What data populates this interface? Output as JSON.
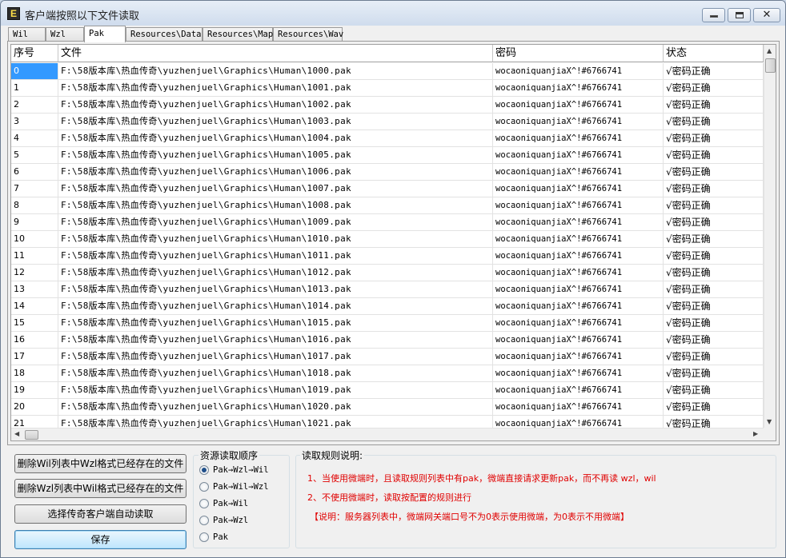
{
  "window": {
    "title": "客户端按照以下文件读取"
  },
  "tabs": [
    "Wil",
    "Wzl",
    "Pak",
    "Resources\\Data",
    "Resources\\Map",
    "Resources\\Wav"
  ],
  "active_tab": "Pak",
  "table": {
    "columns": [
      "序号",
      "文件",
      "密码",
      "状态"
    ],
    "rows": [
      [
        "0",
        "F:\\58版本库\\热血传奇\\yuzhenjuel\\Graphics\\Human\\1000.pak",
        "wocaoniquanjiaX^!#6766741",
        "√密码正确"
      ],
      [
        "1",
        "F:\\58版本库\\热血传奇\\yuzhenjuel\\Graphics\\Human\\1001.pak",
        "wocaoniquanjiaX^!#6766741",
        "√密码正确"
      ],
      [
        "2",
        "F:\\58版本库\\热血传奇\\yuzhenjuel\\Graphics\\Human\\1002.pak",
        "wocaoniquanjiaX^!#6766741",
        "√密码正确"
      ],
      [
        "3",
        "F:\\58版本库\\热血传奇\\yuzhenjuel\\Graphics\\Human\\1003.pak",
        "wocaoniquanjiaX^!#6766741",
        "√密码正确"
      ],
      [
        "4",
        "F:\\58版本库\\热血传奇\\yuzhenjuel\\Graphics\\Human\\1004.pak",
        "wocaoniquanjiaX^!#6766741",
        "√密码正确"
      ],
      [
        "5",
        "F:\\58版本库\\热血传奇\\yuzhenjuel\\Graphics\\Human\\1005.pak",
        "wocaoniquanjiaX^!#6766741",
        "√密码正确"
      ],
      [
        "6",
        "F:\\58版本库\\热血传奇\\yuzhenjuel\\Graphics\\Human\\1006.pak",
        "wocaoniquanjiaX^!#6766741",
        "√密码正确"
      ],
      [
        "7",
        "F:\\58版本库\\热血传奇\\yuzhenjuel\\Graphics\\Human\\1007.pak",
        "wocaoniquanjiaX^!#6766741",
        "√密码正确"
      ],
      [
        "8",
        "F:\\58版本库\\热血传奇\\yuzhenjuel\\Graphics\\Human\\1008.pak",
        "wocaoniquanjiaX^!#6766741",
        "√密码正确"
      ],
      [
        "9",
        "F:\\58版本库\\热血传奇\\yuzhenjuel\\Graphics\\Human\\1009.pak",
        "wocaoniquanjiaX^!#6766741",
        "√密码正确"
      ],
      [
        "10",
        "F:\\58版本库\\热血传奇\\yuzhenjuel\\Graphics\\Human\\1010.pak",
        "wocaoniquanjiaX^!#6766741",
        "√密码正确"
      ],
      [
        "11",
        "F:\\58版本库\\热血传奇\\yuzhenjuel\\Graphics\\Human\\1011.pak",
        "wocaoniquanjiaX^!#6766741",
        "√密码正确"
      ],
      [
        "12",
        "F:\\58版本库\\热血传奇\\yuzhenjuel\\Graphics\\Human\\1012.pak",
        "wocaoniquanjiaX^!#6766741",
        "√密码正确"
      ],
      [
        "13",
        "F:\\58版本库\\热血传奇\\yuzhenjuel\\Graphics\\Human\\1013.pak",
        "wocaoniquanjiaX^!#6766741",
        "√密码正确"
      ],
      [
        "14",
        "F:\\58版本库\\热血传奇\\yuzhenjuel\\Graphics\\Human\\1014.pak",
        "wocaoniquanjiaX^!#6766741",
        "√密码正确"
      ],
      [
        "15",
        "F:\\58版本库\\热血传奇\\yuzhenjuel\\Graphics\\Human\\1015.pak",
        "wocaoniquanjiaX^!#6766741",
        "√密码正确"
      ],
      [
        "16",
        "F:\\58版本库\\热血传奇\\yuzhenjuel\\Graphics\\Human\\1016.pak",
        "wocaoniquanjiaX^!#6766741",
        "√密码正确"
      ],
      [
        "17",
        "F:\\58版本库\\热血传奇\\yuzhenjuel\\Graphics\\Human\\1017.pak",
        "wocaoniquanjiaX^!#6766741",
        "√密码正确"
      ],
      [
        "18",
        "F:\\58版本库\\热血传奇\\yuzhenjuel\\Graphics\\Human\\1018.pak",
        "wocaoniquanjiaX^!#6766741",
        "√密码正确"
      ],
      [
        "19",
        "F:\\58版本库\\热血传奇\\yuzhenjuel\\Graphics\\Human\\1019.pak",
        "wocaoniquanjiaX^!#6766741",
        "√密码正确"
      ],
      [
        "20",
        "F:\\58版本库\\热血传奇\\yuzhenjuel\\Graphics\\Human\\1020.pak",
        "wocaoniquanjiaX^!#6766741",
        "√密码正确"
      ],
      [
        "21",
        "F:\\58版本库\\热血传奇\\yuzhenjuel\\Graphics\\Human\\1021.pak",
        "wocaoniquanjiaX^!#6766741",
        "√密码正确"
      ]
    ]
  },
  "buttons": {
    "delete_wil": "删除Wil列表中Wzl格式已经存在的文件",
    "delete_wzl": "删除Wzl列表中Wil格式已经存在的文件",
    "select_client": "选择传奇客户端自动读取",
    "save": "保存"
  },
  "order_group": {
    "title": "资源读取顺序",
    "options": [
      "Pak→Wzl→Wil",
      "Pak→Wil→Wzl",
      "Pak→Wil",
      "Pak→Wzl",
      "Pak"
    ],
    "selected": "Pak→Wzl→Wil"
  },
  "rules_group": {
    "title": "读取规则说明:",
    "lines": [
      "1、当使用微端时，且读取规则列表中有pak，微端直接请求更新pak，而不再读 wzl，wil",
      "2、不使用微端时，读取按配置的规则进行",
      "【说明：服务器列表中，微端网关端口号不为0表示使用微端，为0表示不用微端】"
    ]
  },
  "colors": {
    "selected_row": "#3399ff",
    "rule_text": "#e00000"
  }
}
